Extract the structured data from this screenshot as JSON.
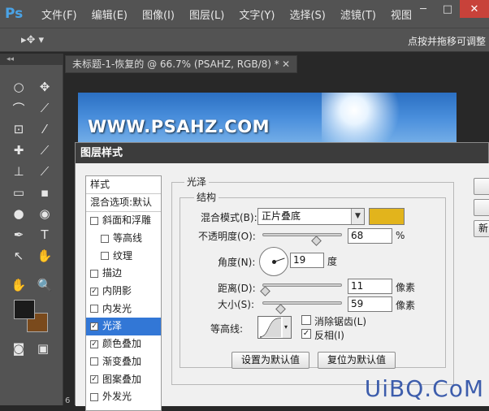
{
  "app": {
    "logo": "Ps"
  },
  "menu": [
    "文件(F)",
    "编辑(E)",
    "图像(I)",
    "图层(L)",
    "文字(Y)",
    "选择(S)",
    "滤镜(T)",
    "视图"
  ],
  "window_controls": {
    "minimize": "─",
    "maximize": "□",
    "close": "✕"
  },
  "options_bar": {
    "tool_glyph": "▸✥ ▾",
    "hint": "点按并拖移可调整"
  },
  "toolbox": {
    "collapse_glyph": "◂◂",
    "tools": [
      "○",
      "✥",
      "⌒",
      "⟋",
      "⊡",
      "⁄",
      "✚",
      "⟋",
      "⊥",
      "⟋",
      "▭",
      "▪",
      "●",
      "◉",
      "✒",
      "T",
      "↖",
      "✋",
      "✋",
      "🔍"
    ],
    "foreground_color": "#1b1b1b",
    "background_color": "#7a4a1c"
  },
  "document": {
    "tab_title": "未标题-1-恢复的 @ 66.7% (PSAHZ, RGB/8) *",
    "close_glyph": "✕",
    "canvas_text": "WWW.PSAHZ.COM",
    "bottom_fragment": "6"
  },
  "dialog": {
    "title": "图层样式",
    "style_list": {
      "header": "样式",
      "blend_options": "混合选项:默认",
      "items": [
        {
          "label": "斜面和浮雕",
          "checked": false,
          "indent": false,
          "selected": false
        },
        {
          "label": "等高线",
          "checked": false,
          "indent": true,
          "selected": false
        },
        {
          "label": "纹理",
          "checked": false,
          "indent": true,
          "selected": false
        },
        {
          "label": "描边",
          "checked": false,
          "indent": false,
          "selected": false
        },
        {
          "label": "内阴影",
          "checked": true,
          "indent": false,
          "selected": false
        },
        {
          "label": "内发光",
          "checked": false,
          "indent": false,
          "selected": false
        },
        {
          "label": "光泽",
          "checked": true,
          "indent": false,
          "selected": true
        },
        {
          "label": "颜色叠加",
          "checked": true,
          "indent": false,
          "selected": false
        },
        {
          "label": "渐变叠加",
          "checked": false,
          "indent": false,
          "selected": false
        },
        {
          "label": "图案叠加",
          "checked": true,
          "indent": false,
          "selected": false
        },
        {
          "label": "外发光",
          "checked": false,
          "indent": false,
          "selected": false
        }
      ]
    },
    "satin": {
      "group_title": "光泽",
      "structure_title": "结构",
      "blend_mode_label": "混合模式(B):",
      "blend_mode_value": "正片叠底",
      "blend_color": "#e2b41c",
      "opacity_label": "不透明度(O):",
      "opacity_value": "68",
      "opacity_unit": "%",
      "opacity_fraction": 0.68,
      "angle_label": "角度(N):",
      "angle_value": "19",
      "angle_unit": "度",
      "distance_label": "距离(D):",
      "distance_value": "11",
      "distance_unit": "像素",
      "distance_fraction": 0.04,
      "size_label": "大小(S):",
      "size_value": "59",
      "size_unit": "像素",
      "size_fraction": 0.236,
      "contour_label": "等高线:",
      "antialias_label": "消除锯齿(L)",
      "antialias_checked": false,
      "invert_label": "反相(I)",
      "invert_checked": true,
      "make_default_button": "设置为默认值",
      "reset_default_button": "复位为默认值"
    },
    "right_buttons": [
      "",
      "",
      "新"
    ]
  },
  "watermark": "UiBQ.CoM"
}
